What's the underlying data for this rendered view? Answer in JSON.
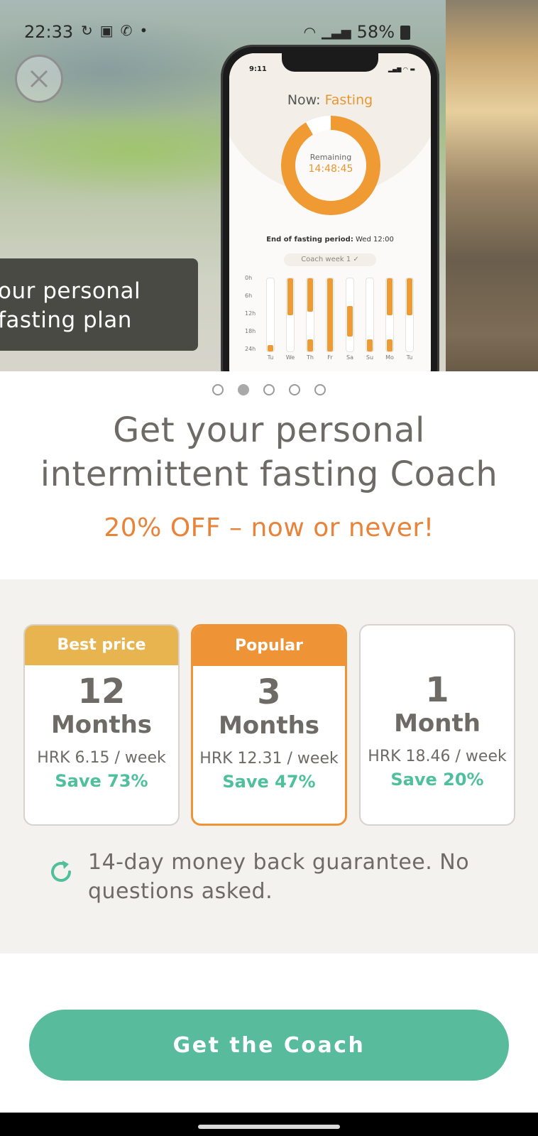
{
  "status_bar": {
    "time": "22:33",
    "battery": "58%"
  },
  "hero": {
    "caption_line1": "our personal",
    "caption_line2": "fasting plan",
    "phone": {
      "time": "9:11",
      "now_prefix": "Now: ",
      "now_state": "Fasting",
      "remaining_label": "Remaining",
      "remaining_time": "14:48:45",
      "end_label": "End of fasting period:",
      "end_value": " Wed 12:00",
      "coach_week": "Coach week 1 ✓",
      "y_labels": [
        "0h",
        "6h",
        "12h",
        "18h",
        "24h"
      ],
      "days": [
        "Tu",
        "We",
        "Th",
        "Fr",
        "Sa",
        "Su",
        "Mo",
        "Tu"
      ]
    }
  },
  "carousel": {
    "dot_count": 5,
    "active_index": 1
  },
  "headline_line1": "Get your personal",
  "headline_line2": "intermittent fasting Coach",
  "discount": "20% OFF – now or never!",
  "plans": [
    {
      "badge": "Best price",
      "badge_color": "#e8b450",
      "number": "12",
      "unit": "Months",
      "price": "HRK 6.15 / week",
      "save": "Save 73%"
    },
    {
      "badge": "Popular",
      "badge_color": "#ef9436",
      "number": "3",
      "unit": "Months",
      "price": "HRK 12.31 / week",
      "save": "Save 47%"
    },
    {
      "badge": "",
      "number": "1",
      "unit": "Month",
      "price": "HRK 18.46 / week",
      "save": "Save 20%"
    }
  ],
  "guarantee_text": "14-day money back guarantee. No questions asked.",
  "cta_label": "Get the Coach",
  "colors": {
    "accent_green": "#57bb9c",
    "accent_orange": "#e8833a",
    "text_gray": "#6e6a65"
  },
  "icons": {
    "close": "close-icon",
    "guarantee": "refresh-icon"
  }
}
